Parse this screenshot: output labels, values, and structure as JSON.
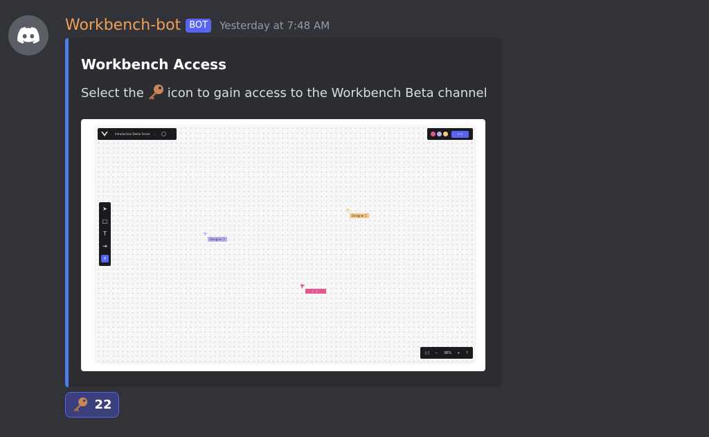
{
  "message": {
    "author": "Workbench-bot",
    "bot_tag": "BOT",
    "timestamp": "Yesterday at 7:48 AM"
  },
  "embed": {
    "title": "Workbench Access",
    "description_before": "Select the",
    "description_icon": "key-icon",
    "description_after": "icon to gain access to the Workbench Beta channel",
    "accent_color": "#4a7fe8",
    "image": {
      "scene_title": "Introduction Demo Scene",
      "cursor_labels": [
        "Designer 1",
        "Designer 2",
        "( . ) ."
      ],
      "cursor_colors": [
        "#f5c98a",
        "#b9b1ef",
        "#e4578f"
      ],
      "zoom_label": "38%",
      "help": "?"
    }
  },
  "reaction": {
    "icon": "key-icon",
    "count": "22"
  },
  "colors": {
    "username": "#f0a054",
    "bot_tag_bg": "#5865f2",
    "background": "#313338",
    "embed_bg": "#2b2d31"
  }
}
